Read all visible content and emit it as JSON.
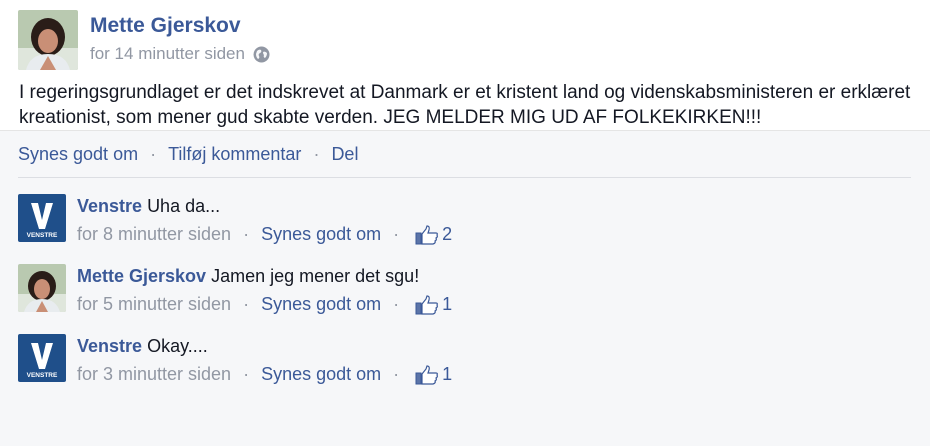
{
  "post": {
    "author": "Mette Gjerskov",
    "time": "for 14 minutter siden",
    "text": "I regeringsgrundlaget er det indskrevet at Danmark er et kristent land og videnskabsministeren er erklæret kreationist, som mener gud skabte verden. JEG MELDER MIG UD AF FOLKEKIRKEN!!!",
    "privacy_icon": "globe-icon"
  },
  "actions": {
    "like": "Synes godt om",
    "comment": "Tilføj kommentar",
    "share": "Del",
    "separator": "·"
  },
  "comments": [
    {
      "author": "Venstre",
      "text": "Uha da...",
      "time": "for 8 minutter siden",
      "like": "Synes godt om",
      "likes": "2",
      "avatar": "venstre-logo"
    },
    {
      "author": "Mette Gjerskov",
      "text": "Jamen jeg mener det sgu!",
      "time": "for 5 minutter siden",
      "like": "Synes godt om",
      "likes": "1",
      "avatar": "photo"
    },
    {
      "author": "Venstre",
      "text": "Okay....",
      "time": "for 3 minutter siden",
      "like": "Synes godt om",
      "likes": "1",
      "avatar": "venstre-logo"
    }
  ],
  "logo": {
    "letter": "V",
    "word": "VENSTRE"
  },
  "colors": {
    "link": "#3b5998",
    "muted": "#9197a3",
    "background": "#f6f7f9",
    "venstre_blue": "#1f4f8a"
  }
}
